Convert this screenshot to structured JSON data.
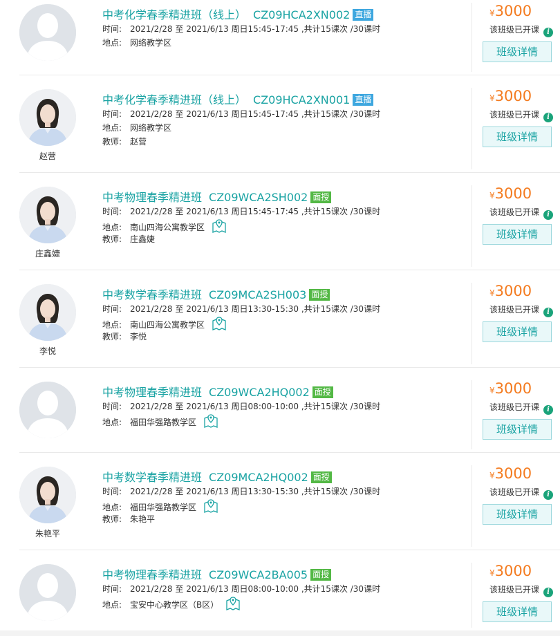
{
  "labels": {
    "time": "时间:",
    "location": "地点:",
    "teacher": "教师:",
    "to": "至",
    "yen": "¥",
    "status": "该班级已开课",
    "detail": "班级详情",
    "info_icon": "i"
  },
  "courses": [
    {
      "title": "中考化学春季精进班（线上）",
      "code": "CZ09HCA2XN002",
      "badge": "直播",
      "start": "2021/2/28",
      "end": "2021/6/13 周日15:45-17:45 ,共计15课次 /30课时",
      "location": "网络教学区",
      "teacher": "",
      "price": "3000",
      "avatar": "placeholder-avatar-icon"
    },
    {
      "title": "中考化学春季精进班（线上）",
      "code": "CZ09HCA2XN001",
      "badge": "直播",
      "start": "2021/2/28",
      "end": "2021/6/13 周日15:45-17:45 ,共计15课次 /30课时",
      "location": "网络教学区",
      "teacher": "赵营",
      "price": "3000",
      "avatar": "teacher-photo"
    },
    {
      "title": "中考物理春季精进班",
      "code": "CZ09WCA2SH002",
      "badge": "面授",
      "start": "2021/2/28",
      "end": "2021/6/13 周日15:45-17:45 ,共计15课次 /30课时",
      "location": "南山四海公寓教学区",
      "teacher": "庄鑫婕",
      "price": "3000",
      "avatar": "teacher-photo"
    },
    {
      "title": "中考数学春季精进班",
      "code": "CZ09MCA2SH003",
      "badge": "面授",
      "start": "2021/2/28",
      "end": "2021/6/13 周日13:30-15:30 ,共计15课次 /30课时",
      "location": "南山四海公寓教学区",
      "teacher": "李悦",
      "price": "3000",
      "avatar": "teacher-photo"
    },
    {
      "title": "中考物理春季精进班",
      "code": "CZ09WCA2HQ002",
      "badge": "面授",
      "start": "2021/2/28",
      "end": "2021/6/13 周日08:00-10:00 ,共计15课次 /30课时",
      "location": "福田华强路教学区",
      "teacher": "",
      "price": "3000",
      "avatar": "placeholder-avatar-icon"
    },
    {
      "title": "中考数学春季精进班",
      "code": "CZ09MCA2HQ002",
      "badge": "面授",
      "start": "2021/2/28",
      "end": "2021/6/13 周日13:30-15:30 ,共计15课次 /30课时",
      "location": "福田华强路教学区",
      "teacher": "朱艳平",
      "price": "3000",
      "avatar": "teacher-photo"
    },
    {
      "title": "中考物理春季精进班",
      "code": "CZ09WCA2BA005",
      "badge": "面授",
      "start": "2021/2/28",
      "end": "2021/6/13 周日08:00-10:00 ,共计15课次 /30课时",
      "location": "宝安中心教学区（B区）",
      "teacher": "",
      "price": "3000",
      "avatar": "placeholder-avatar-icon"
    }
  ],
  "colors": {
    "accent": "#1aa3a3",
    "price": "#f47b1f",
    "live_badge": "#3ea7df",
    "face_badge": "#53b845",
    "info_icon": "#1aa37a"
  }
}
